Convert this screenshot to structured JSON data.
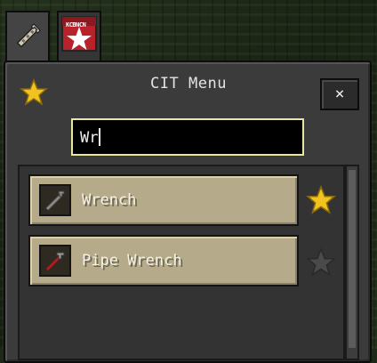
{
  "tabs": [
    {
      "name": "wrench-tab",
      "icon": "wrench-icon",
      "active": true
    },
    {
      "name": "cit-tab",
      "icon": "star-badge-icon",
      "badge_text": "KCBNCN",
      "active": false
    }
  ],
  "menu": {
    "title": "CIT Menu",
    "close_label": "×",
    "favorite_icon": "star-icon"
  },
  "search": {
    "value": "Wr",
    "placeholder": ""
  },
  "items": [
    {
      "label": "Wrench",
      "icon": "wrench-icon",
      "favorite": true
    },
    {
      "label": "Pipe Wrench",
      "icon": "pipe-wrench-icon",
      "favorite": false
    }
  ],
  "colors": {
    "star_gold": "#f2c21e",
    "row_bg": "#b5ab8a",
    "search_border": "#e8e8a0"
  }
}
